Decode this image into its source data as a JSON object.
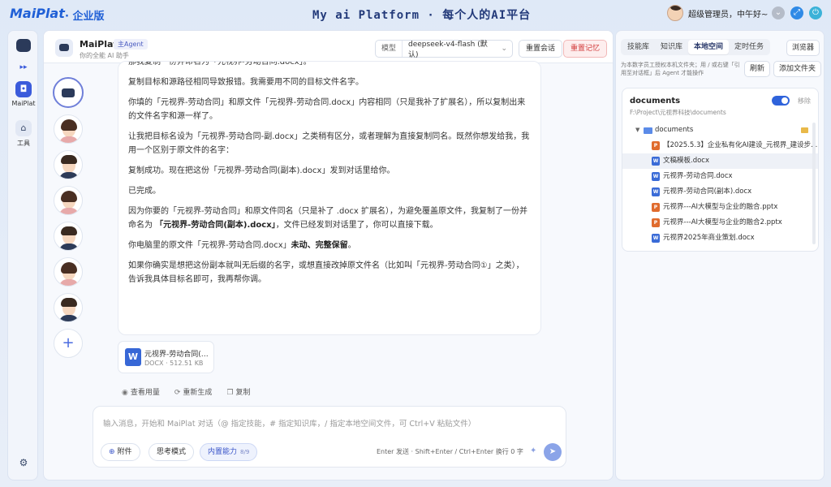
{
  "app": {
    "logo": "MaiPlat",
    "edition": "· 企业版",
    "title": "My ai Platform  ·  每个人的AI平台",
    "user_name": "超级管理员，中午好~",
    "colors": {
      "accent": "#2f63db",
      "danger": "#d23b3b",
      "minimize": "#b5bcc8",
      "maximize": "#2f8ae6",
      "close": "#3bb2d8"
    }
  },
  "rail": {
    "items": [
      {
        "label": "MaiPlat",
        "icon": "robot-icon"
      },
      {
        "label": "工具",
        "icon": "home-icon"
      }
    ],
    "settings_icon": "gear-icon"
  },
  "chat_header": {
    "agent_name": "MaiPlat",
    "agent_tag": "主Agent",
    "agent_subtitle": "你的全能 AI 助手",
    "model_label": "模型",
    "model_value": "deepseek-v4-flash (默认)",
    "reset_session": "重置会话",
    "reset_memory": "重置记忆"
  },
  "message": {
    "p0": "那我复制一份并命名为「元视界-劳动合同.docx」。",
    "p1": "复制目标和源路径相同导致报错。我需要用不同的目标文件名字。",
    "p2": "你填的「元视界-劳动合同」和原文件「元视界-劳动合同.docx」内容相同（只是我补了扩展名），所以复制出来的文件名字和源一样了。",
    "p3": "让我把目标名设为「元视界-劳动合同-副.docx」之类稍有区分，或者理解为直接复制同名。既然你想发给我，我用一个区别于原文件的名字：",
    "p4": "复制成功。现在把这份「元视界-劳动合同(副本).docx」发到对话里给你。",
    "p5": "已完成。",
    "p6a": "因为你要的「元视界-劳动合同」和原文件同名（只是补了 .docx 扩展名），为避免覆盖原文件，我复制了一份并命名为 ",
    "p6b": "「元视界-劳动合同(副本).docx」",
    "p6c": "，文件已经发到对话里了，你可以直接下载。",
    "p7a": "你电脑里的原文件「元视界-劳动合同.docx」",
    "p7b": "未动、完整保留",
    "p7c": "。",
    "p8": "如果你确实是想把这份副本就叫无后缀的名字，或想直接改掉原文件名（比如叫「元视界-劳动合同①」之类），告诉我具体目标名即可，我再帮你调。"
  },
  "attachment": {
    "name": "元视界-劳动合同(…",
    "meta": "DOCX · 512.51 KB",
    "icon_letter": "W"
  },
  "actions": {
    "usage": "查看用量",
    "regenerate": "重新生成",
    "copy": "复制"
  },
  "composer": {
    "placeholder": "输入消息，开始和 MaiPlat 对话（@ 指定技能，# 指定知识库，/ 指定本地空间文件，可 Ctrl+V 粘贴文件）",
    "attach": "附件",
    "think": "思考模式",
    "builtin": "内置能力",
    "builtin_count": "8/9",
    "hint": "Enter 发送 · Shift+Enter / Ctrl+Enter 换行   0 字"
  },
  "right_panel": {
    "tabs": [
      "技能库",
      "知识库",
      "本地空间",
      "定时任务"
    ],
    "active_tab": "本地空间",
    "browse": "浏览器",
    "note": "为本数字员工授权本机文件夹；用 / 或右键「引用至对话框」后 Agent 才能操作",
    "refresh": "刷新",
    "add_folder": "添加文件夹",
    "folder": {
      "title": "documents",
      "path": "F:\\Project\\元视界科技\\documents",
      "remove": "移除",
      "root": "documents",
      "files": [
        {
          "name": "【2025.5.3】企业私有化AI建设_元视界_建设步...",
          "type": "p"
        },
        {
          "name": "文稿模板.docx",
          "type": "w"
        },
        {
          "name": "元视界-劳动合同.docx",
          "type": "w"
        },
        {
          "name": "元视界-劳动合同(副本).docx",
          "type": "w"
        },
        {
          "name": "元视界---AI大模型与企业的融合.pptx",
          "type": "p"
        },
        {
          "name": "元视界---AI大模型与企业的融合2.pptx",
          "type": "p"
        },
        {
          "name": "元视界2025年商业策划.docx",
          "type": "w"
        }
      ]
    }
  }
}
